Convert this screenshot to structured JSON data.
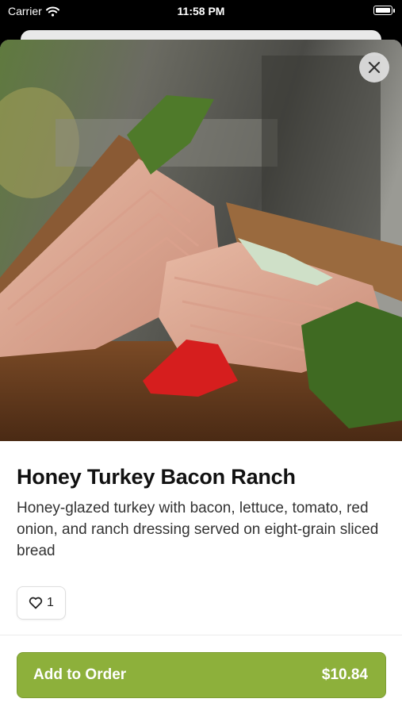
{
  "status_bar": {
    "carrier": "Carrier",
    "time": "11:58 PM"
  },
  "item": {
    "title": "Honey Turkey Bacon Ranch",
    "description": "Honey-glazed turkey with bacon, lettuce, tomato, red onion, and ranch dressing served on eight-grain sliced bread",
    "likes": "1",
    "image": "sandwich-photo"
  },
  "actions": {
    "add_label": "Add to Order",
    "price": "$10.84",
    "close_icon": "close-icon",
    "like_icon": "heart-icon"
  },
  "colors": {
    "accent": "#8db03b"
  }
}
